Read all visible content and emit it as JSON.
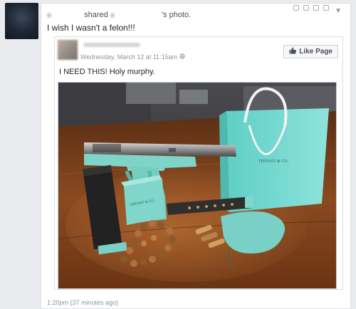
{
  "post": {
    "header_verb": "shared",
    "header_suffix": "'s photo.",
    "status_text": "I wish I wasn't a felon!!!",
    "footer_time": "1:20pm (37 minutes ago)"
  },
  "shared_post": {
    "timestamp": "Wednesday, March 12 at 11:15am",
    "like_page_label": "Like Page",
    "caption": "I NEED THIS! Holy murphy.",
    "bag_brand": "TIFFANY & CO.",
    "box_brand": "TIFFANY & CO."
  },
  "icons": {
    "privacy": "globe-icon",
    "like": "thumbs-up-icon",
    "menu": "chevron-down-icon"
  },
  "colors": {
    "tiffany_blue": "#81d8d0",
    "facebook_text": "#4b4f56"
  }
}
